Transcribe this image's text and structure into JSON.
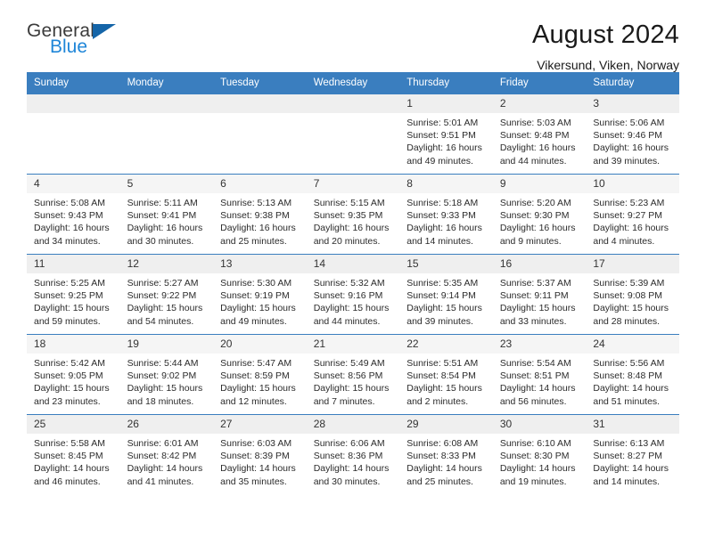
{
  "brand": {
    "line1": "General",
    "line2": "Blue",
    "triangle_color": "#1565a8",
    "blue_color": "#1f86d8"
  },
  "header": {
    "title": "August 2024",
    "subtitle": "Vikersund, Viken, Norway"
  },
  "theme": {
    "header_bg": "#3a7ebf",
    "header_text": "#ffffff",
    "daynum_bg": "#efefef",
    "row_border": "#3a7ebf"
  },
  "weekday_headers": [
    "Sunday",
    "Monday",
    "Tuesday",
    "Wednesday",
    "Thursday",
    "Friday",
    "Saturday"
  ],
  "weeks": [
    [
      {
        "day": "",
        "sunrise": "",
        "sunset": "",
        "daylight_line1": "",
        "daylight_line2": ""
      },
      {
        "day": "",
        "sunrise": "",
        "sunset": "",
        "daylight_line1": "",
        "daylight_line2": ""
      },
      {
        "day": "",
        "sunrise": "",
        "sunset": "",
        "daylight_line1": "",
        "daylight_line2": ""
      },
      {
        "day": "",
        "sunrise": "",
        "sunset": "",
        "daylight_line1": "",
        "daylight_line2": ""
      },
      {
        "day": "1",
        "sunrise": "Sunrise: 5:01 AM",
        "sunset": "Sunset: 9:51 PM",
        "daylight_line1": "Daylight: 16 hours",
        "daylight_line2": "and 49 minutes."
      },
      {
        "day": "2",
        "sunrise": "Sunrise: 5:03 AM",
        "sunset": "Sunset: 9:48 PM",
        "daylight_line1": "Daylight: 16 hours",
        "daylight_line2": "and 44 minutes."
      },
      {
        "day": "3",
        "sunrise": "Sunrise: 5:06 AM",
        "sunset": "Sunset: 9:46 PM",
        "daylight_line1": "Daylight: 16 hours",
        "daylight_line2": "and 39 minutes."
      }
    ],
    [
      {
        "day": "4",
        "sunrise": "Sunrise: 5:08 AM",
        "sunset": "Sunset: 9:43 PM",
        "daylight_line1": "Daylight: 16 hours",
        "daylight_line2": "and 34 minutes."
      },
      {
        "day": "5",
        "sunrise": "Sunrise: 5:11 AM",
        "sunset": "Sunset: 9:41 PM",
        "daylight_line1": "Daylight: 16 hours",
        "daylight_line2": "and 30 minutes."
      },
      {
        "day": "6",
        "sunrise": "Sunrise: 5:13 AM",
        "sunset": "Sunset: 9:38 PM",
        "daylight_line1": "Daylight: 16 hours",
        "daylight_line2": "and 25 minutes."
      },
      {
        "day": "7",
        "sunrise": "Sunrise: 5:15 AM",
        "sunset": "Sunset: 9:35 PM",
        "daylight_line1": "Daylight: 16 hours",
        "daylight_line2": "and 20 minutes."
      },
      {
        "day": "8",
        "sunrise": "Sunrise: 5:18 AM",
        "sunset": "Sunset: 9:33 PM",
        "daylight_line1": "Daylight: 16 hours",
        "daylight_line2": "and 14 minutes."
      },
      {
        "day": "9",
        "sunrise": "Sunrise: 5:20 AM",
        "sunset": "Sunset: 9:30 PM",
        "daylight_line1": "Daylight: 16 hours",
        "daylight_line2": "and 9 minutes."
      },
      {
        "day": "10",
        "sunrise": "Sunrise: 5:23 AM",
        "sunset": "Sunset: 9:27 PM",
        "daylight_line1": "Daylight: 16 hours",
        "daylight_line2": "and 4 minutes."
      }
    ],
    [
      {
        "day": "11",
        "sunrise": "Sunrise: 5:25 AM",
        "sunset": "Sunset: 9:25 PM",
        "daylight_line1": "Daylight: 15 hours",
        "daylight_line2": "and 59 minutes."
      },
      {
        "day": "12",
        "sunrise": "Sunrise: 5:27 AM",
        "sunset": "Sunset: 9:22 PM",
        "daylight_line1": "Daylight: 15 hours",
        "daylight_line2": "and 54 minutes."
      },
      {
        "day": "13",
        "sunrise": "Sunrise: 5:30 AM",
        "sunset": "Sunset: 9:19 PM",
        "daylight_line1": "Daylight: 15 hours",
        "daylight_line2": "and 49 minutes."
      },
      {
        "day": "14",
        "sunrise": "Sunrise: 5:32 AM",
        "sunset": "Sunset: 9:16 PM",
        "daylight_line1": "Daylight: 15 hours",
        "daylight_line2": "and 44 minutes."
      },
      {
        "day": "15",
        "sunrise": "Sunrise: 5:35 AM",
        "sunset": "Sunset: 9:14 PM",
        "daylight_line1": "Daylight: 15 hours",
        "daylight_line2": "and 39 minutes."
      },
      {
        "day": "16",
        "sunrise": "Sunrise: 5:37 AM",
        "sunset": "Sunset: 9:11 PM",
        "daylight_line1": "Daylight: 15 hours",
        "daylight_line2": "and 33 minutes."
      },
      {
        "day": "17",
        "sunrise": "Sunrise: 5:39 AM",
        "sunset": "Sunset: 9:08 PM",
        "daylight_line1": "Daylight: 15 hours",
        "daylight_line2": "and 28 minutes."
      }
    ],
    [
      {
        "day": "18",
        "sunrise": "Sunrise: 5:42 AM",
        "sunset": "Sunset: 9:05 PM",
        "daylight_line1": "Daylight: 15 hours",
        "daylight_line2": "and 23 minutes."
      },
      {
        "day": "19",
        "sunrise": "Sunrise: 5:44 AM",
        "sunset": "Sunset: 9:02 PM",
        "daylight_line1": "Daylight: 15 hours",
        "daylight_line2": "and 18 minutes."
      },
      {
        "day": "20",
        "sunrise": "Sunrise: 5:47 AM",
        "sunset": "Sunset: 8:59 PM",
        "daylight_line1": "Daylight: 15 hours",
        "daylight_line2": "and 12 minutes."
      },
      {
        "day": "21",
        "sunrise": "Sunrise: 5:49 AM",
        "sunset": "Sunset: 8:56 PM",
        "daylight_line1": "Daylight: 15 hours",
        "daylight_line2": "and 7 minutes."
      },
      {
        "day": "22",
        "sunrise": "Sunrise: 5:51 AM",
        "sunset": "Sunset: 8:54 PM",
        "daylight_line1": "Daylight: 15 hours",
        "daylight_line2": "and 2 minutes."
      },
      {
        "day": "23",
        "sunrise": "Sunrise: 5:54 AM",
        "sunset": "Sunset: 8:51 PM",
        "daylight_line1": "Daylight: 14 hours",
        "daylight_line2": "and 56 minutes."
      },
      {
        "day": "24",
        "sunrise": "Sunrise: 5:56 AM",
        "sunset": "Sunset: 8:48 PM",
        "daylight_line1": "Daylight: 14 hours",
        "daylight_line2": "and 51 minutes."
      }
    ],
    [
      {
        "day": "25",
        "sunrise": "Sunrise: 5:58 AM",
        "sunset": "Sunset: 8:45 PM",
        "daylight_line1": "Daylight: 14 hours",
        "daylight_line2": "and 46 minutes."
      },
      {
        "day": "26",
        "sunrise": "Sunrise: 6:01 AM",
        "sunset": "Sunset: 8:42 PM",
        "daylight_line1": "Daylight: 14 hours",
        "daylight_line2": "and 41 minutes."
      },
      {
        "day": "27",
        "sunrise": "Sunrise: 6:03 AM",
        "sunset": "Sunset: 8:39 PM",
        "daylight_line1": "Daylight: 14 hours",
        "daylight_line2": "and 35 minutes."
      },
      {
        "day": "28",
        "sunrise": "Sunrise: 6:06 AM",
        "sunset": "Sunset: 8:36 PM",
        "daylight_line1": "Daylight: 14 hours",
        "daylight_line2": "and 30 minutes."
      },
      {
        "day": "29",
        "sunrise": "Sunrise: 6:08 AM",
        "sunset": "Sunset: 8:33 PM",
        "daylight_line1": "Daylight: 14 hours",
        "daylight_line2": "and 25 minutes."
      },
      {
        "day": "30",
        "sunrise": "Sunrise: 6:10 AM",
        "sunset": "Sunset: 8:30 PM",
        "daylight_line1": "Daylight: 14 hours",
        "daylight_line2": "and 19 minutes."
      },
      {
        "day": "31",
        "sunrise": "Sunrise: 6:13 AM",
        "sunset": "Sunset: 8:27 PM",
        "daylight_line1": "Daylight: 14 hours",
        "daylight_line2": "and 14 minutes."
      }
    ]
  ]
}
